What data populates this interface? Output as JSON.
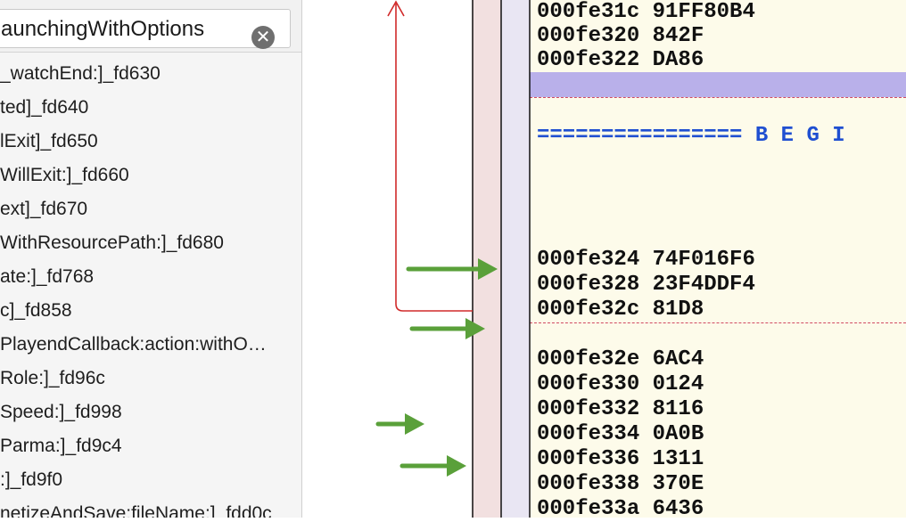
{
  "search": {
    "value": "aunchingWithOptions",
    "clear_icon": "clear-icon"
  },
  "functions": [
    "_watchEnd:]_fd630",
    "ted]_fd640",
    "lExit]_fd650",
    "WillExit:]_fd660",
    "ext]_fd670",
    "WithResourcePath:]_fd680",
    "ate:]_fd768",
    "c]_fd858",
    "PlayendCallback:action:withO…",
    "Role:]_fd96c",
    "Speed:]_fd998",
    "Parma:]_fd9c4",
    ":]_fd9f0",
    "netizeAndSave:fileName:]_fdd0c"
  ],
  "code": {
    "top_lines": [
      "000fe31c 91FF80B4",
      "000fe320 842F",
      "000fe322 DA86"
    ],
    "begin_label": "================ B E G I",
    "block_a": [
      "000fe324 74F016F6",
      "000fe328 23F4DDF4",
      "000fe32c 81D8"
    ],
    "block_b": [
      "000fe32e 6AC4",
      "000fe330 0124",
      "000fe332 8116",
      "000fe334 0A0B",
      "000fe336 1311",
      "000fe338 370E",
      "000fe33a 6436"
    ]
  },
  "colors": {
    "code_bg": "#fdfbea",
    "highlight": "#b9b0ea",
    "begin_text": "#1f4fd1",
    "edge_red": "#d02a2a",
    "arrow_green": "#5aa03a",
    "lane_pink": "#f2e0e0",
    "lane_lavender": "#e9e6f3"
  }
}
